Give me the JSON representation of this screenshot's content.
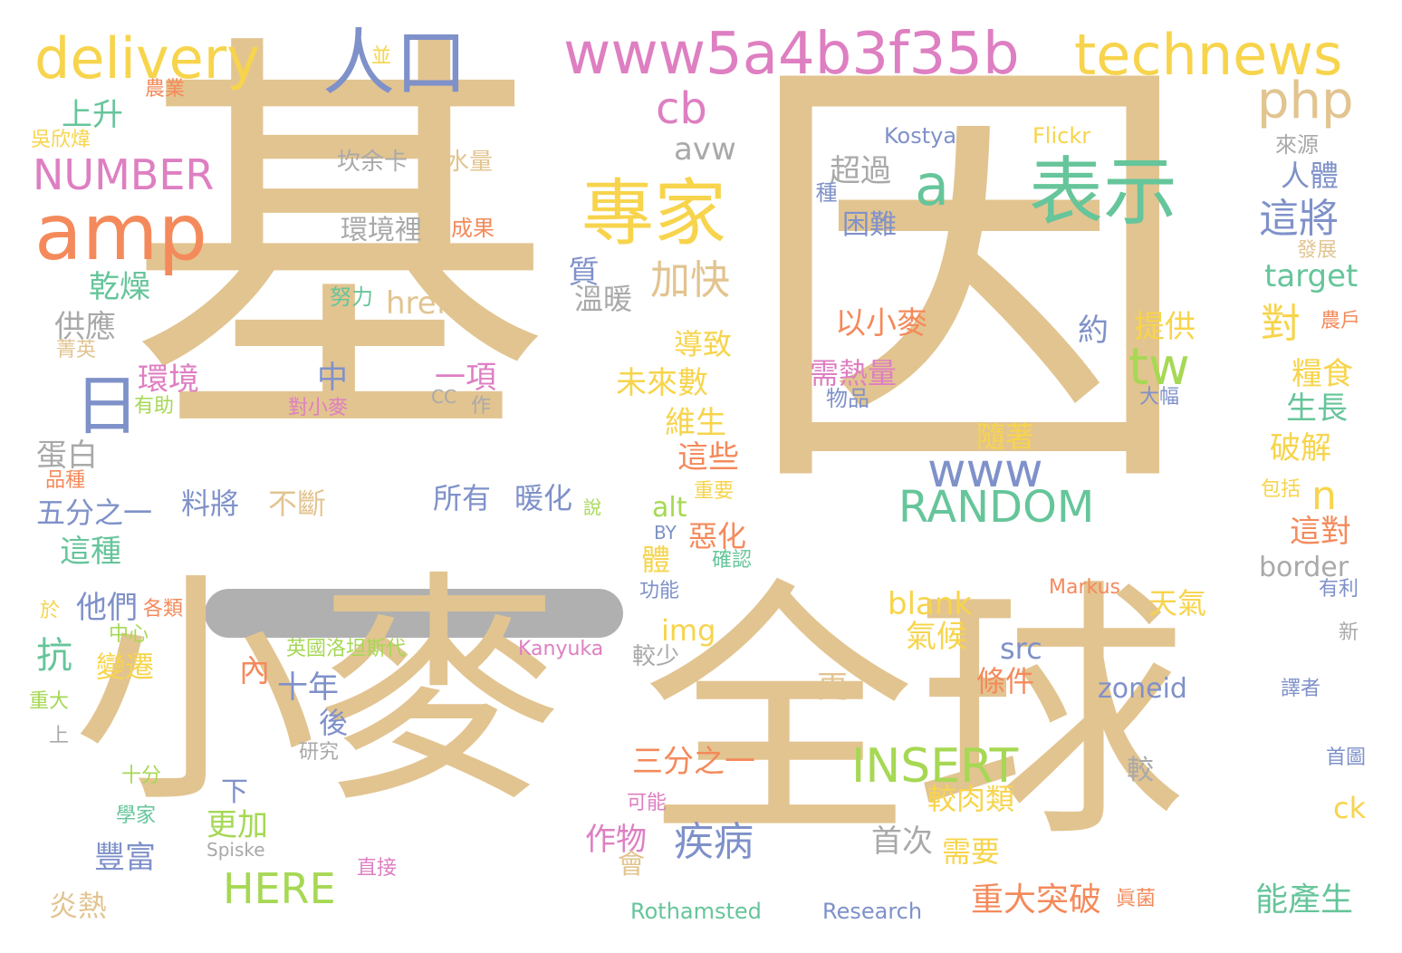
{
  "palette": {
    "tan": "#e2c490",
    "orange": "#f48a5b",
    "yellow": "#f7d44c",
    "pink": "#de7fc2",
    "blue": "#7f91c9",
    "green": "#66c59a",
    "lime": "#a6d854",
    "gray": "#a9a9a9"
  },
  "words": [
    {
      "text": "基",
      "size": 470,
      "color": "tan"
    },
    {
      "text": "因",
      "size": 500,
      "color": "tan"
    },
    {
      "text": "全球",
      "size": 300,
      "color": "tan"
    },
    {
      "text": "小麥",
      "size": 270,
      "color": "tan"
    },
    {
      "text": "amp",
      "size": 86,
      "color": "orange"
    },
    {
      "text": "delivery",
      "size": 62,
      "color": "yellow"
    },
    {
      "text": "人口",
      "size": 80,
      "color": "blue"
    },
    {
      "text": "www5a4b3f35b",
      "size": 64,
      "color": "pink"
    },
    {
      "text": "technews",
      "size": 62,
      "color": "yellow"
    },
    {
      "text": "php",
      "size": 56,
      "color": "tan"
    },
    {
      "text": "cb",
      "size": 48,
      "color": "pink"
    },
    {
      "text": "專家",
      "size": 80,
      "color": "yellow"
    },
    {
      "text": "a",
      "size": 62,
      "color": "green"
    },
    {
      "text": "表示",
      "size": 82,
      "color": "green"
    },
    {
      "text": "NUMBER",
      "size": 46,
      "color": "pink"
    },
    {
      "text": "上升",
      "size": 34,
      "color": "green"
    },
    {
      "text": "吳欣煒",
      "size": 22,
      "color": "yellow"
    },
    {
      "text": "農業",
      "size": 22,
      "color": "orange"
    },
    {
      "text": "並",
      "size": 22,
      "color": "yellow"
    },
    {
      "text": "日",
      "size": 72,
      "color": "blue"
    },
    {
      "text": "avw",
      "size": 34,
      "color": "gray"
    },
    {
      "text": "Kostya",
      "size": 24,
      "color": "blue"
    },
    {
      "text": "Flickr",
      "size": 24,
      "color": "yellow"
    },
    {
      "text": "來源",
      "size": 24,
      "color": "gray"
    },
    {
      "text": "坎余卡",
      "size": 26,
      "color": "gray"
    },
    {
      "text": "需水量",
      "size": 26,
      "color": "tan"
    },
    {
      "text": "超過",
      "size": 34,
      "color": "gray"
    },
    {
      "text": "人體",
      "size": 32,
      "color": "blue"
    },
    {
      "text": "這將",
      "size": 44,
      "color": "blue"
    },
    {
      "text": "種",
      "size": 24,
      "color": "blue"
    },
    {
      "text": "困難",
      "size": 30,
      "color": "blue"
    },
    {
      "text": "環境裡",
      "size": 30,
      "color": "gray"
    },
    {
      "text": "成果",
      "size": 24,
      "color": "orange"
    },
    {
      "text": "加快",
      "size": 44,
      "color": "tan"
    },
    {
      "text": "發展",
      "size": 22,
      "color": "tan"
    },
    {
      "text": "target",
      "size": 34,
      "color": "green"
    },
    {
      "text": "乾燥",
      "size": 34,
      "color": "green"
    },
    {
      "text": "努力",
      "size": 24,
      "color": "green"
    },
    {
      "text": "href",
      "size": 34,
      "color": "tan"
    },
    {
      "text": "質",
      "size": 34,
      "color": "blue"
    },
    {
      "text": "溫暖",
      "size": 32,
      "color": "gray"
    },
    {
      "text": "以小麥",
      "size": 34,
      "color": "orange"
    },
    {
      "text": "約",
      "size": 34,
      "color": "blue"
    },
    {
      "text": "提供",
      "size": 34,
      "color": "yellow"
    },
    {
      "text": "對",
      "size": 44,
      "color": "yellow"
    },
    {
      "text": "農戶",
      "size": 22,
      "color": "orange"
    },
    {
      "text": "供應",
      "size": 34,
      "color": "gray"
    },
    {
      "text": "菁英",
      "size": 22,
      "color": "tan"
    },
    {
      "text": "導致",
      "size": 32,
      "color": "yellow"
    },
    {
      "text": "tw",
      "size": 56,
      "color": "lime"
    },
    {
      "text": "糧食",
      "size": 34,
      "color": "yellow"
    },
    {
      "text": "環境",
      "size": 34,
      "color": "pink"
    },
    {
      "text": "中",
      "size": 34,
      "color": "blue"
    },
    {
      "text": "一項",
      "size": 34,
      "color": "pink"
    },
    {
      "text": "未來數",
      "size": 34,
      "color": "yellow"
    },
    {
      "text": "需熱量",
      "size": 32,
      "color": "pink"
    },
    {
      "text": "有助",
      "size": 22,
      "color": "lime"
    },
    {
      "text": "對小麥",
      "size": 22,
      "color": "pink"
    },
    {
      "text": "CC",
      "size": 20,
      "color": "gray"
    },
    {
      "text": "作",
      "size": 22,
      "color": "gray"
    },
    {
      "text": "物品",
      "size": 24,
      "color": "blue"
    },
    {
      "text": "大幅",
      "size": 22,
      "color": "blue"
    },
    {
      "text": "生長",
      "size": 34,
      "color": "green"
    },
    {
      "text": "維生",
      "size": 34,
      "color": "yellow"
    },
    {
      "text": "隨著",
      "size": 32,
      "color": "yellow"
    },
    {
      "text": "蛋白",
      "size": 34,
      "color": "gray"
    },
    {
      "text": "這些",
      "size": 34,
      "color": "orange"
    },
    {
      "text": "www",
      "size": 52,
      "color": "blue"
    },
    {
      "text": "破解",
      "size": 34,
      "color": "yellow"
    },
    {
      "text": "品種",
      "size": 22,
      "color": "orange"
    },
    {
      "text": "n",
      "size": 44,
      "color": "yellow"
    },
    {
      "text": "包括",
      "size": 22,
      "color": "yellow"
    },
    {
      "text": "五分之一",
      "size": 32,
      "color": "blue"
    },
    {
      "text": "料將",
      "size": 32,
      "color": "blue"
    },
    {
      "text": "不斷",
      "size": 32,
      "color": "tan"
    },
    {
      "text": "所有",
      "size": 32,
      "color": "blue"
    },
    {
      "text": "暖化",
      "size": 32,
      "color": "blue"
    },
    {
      "text": "說",
      "size": 20,
      "color": "lime"
    },
    {
      "text": "RANDOM",
      "size": 48,
      "color": "green"
    },
    {
      "text": "alt",
      "size": 30,
      "color": "lime"
    },
    {
      "text": "重要",
      "size": 22,
      "color": "yellow"
    },
    {
      "text": "這對",
      "size": 34,
      "color": "orange"
    },
    {
      "text": "這種",
      "size": 34,
      "color": "green"
    },
    {
      "text": "BY",
      "size": 20,
      "color": "blue"
    },
    {
      "text": "惡化",
      "size": 32,
      "color": "orange"
    },
    {
      "text": "體",
      "size": 32,
      "color": "yellow"
    },
    {
      "text": "確認",
      "size": 22,
      "color": "green"
    },
    {
      "text": "border",
      "size": 30,
      "color": "gray"
    },
    {
      "text": "功能",
      "size": 22,
      "color": "blue"
    },
    {
      "text": "Markus",
      "size": 22,
      "color": "orange"
    },
    {
      "text": "有利",
      "size": 22,
      "color": "blue"
    },
    {
      "text": "於",
      "size": 22,
      "color": "yellow"
    },
    {
      "text": "各類",
      "size": 22,
      "color": "orange"
    },
    {
      "text": "他們",
      "size": 34,
      "color": "blue"
    },
    {
      "text": "blank",
      "size": 34,
      "color": "yellow"
    },
    {
      "text": "天氣",
      "size": 32,
      "color": "yellow"
    },
    {
      "text": "中心",
      "size": 22,
      "color": "lime"
    },
    {
      "text": "img",
      "size": 32,
      "color": "yellow"
    },
    {
      "text": "氣候",
      "size": 34,
      "color": "yellow"
    },
    {
      "text": "新",
      "size": 22,
      "color": "gray"
    },
    {
      "text": "抗",
      "size": 40,
      "color": "green"
    },
    {
      "text": "英國洛坦斯代",
      "size": 22,
      "color": "lime"
    },
    {
      "text": "Kanyuka",
      "size": 22,
      "color": "pink"
    },
    {
      "text": "較少",
      "size": 26,
      "color": "gray"
    },
    {
      "text": "src",
      "size": 32,
      "color": "blue"
    },
    {
      "text": "變遷",
      "size": 32,
      "color": "yellow"
    },
    {
      "text": "內",
      "size": 34,
      "color": "orange"
    },
    {
      "text": "十年",
      "size": 34,
      "color": "blue"
    },
    {
      "text": "條件",
      "size": 32,
      "color": "orange"
    },
    {
      "text": "zoneid",
      "size": 30,
      "color": "blue"
    },
    {
      "text": "譯者",
      "size": 22,
      "color": "blue"
    },
    {
      "text": "重大",
      "size": 22,
      "color": "lime"
    },
    {
      "text": "更",
      "size": 34,
      "color": "tan"
    },
    {
      "text": "後",
      "size": 32,
      "color": "blue"
    },
    {
      "text": "上",
      "size": 22,
      "color": "gray"
    },
    {
      "text": "研究",
      "size": 22,
      "color": "gray"
    },
    {
      "text": "INSERT",
      "size": 52,
      "color": "lime"
    },
    {
      "text": "三分之一",
      "size": 34,
      "color": "orange"
    },
    {
      "text": "首圖",
      "size": 22,
      "color": "blue"
    },
    {
      "text": "十分",
      "size": 22,
      "color": "lime"
    },
    {
      "text": "較",
      "size": 30,
      "color": "gray"
    },
    {
      "text": "下",
      "size": 30,
      "color": "blue"
    },
    {
      "text": "可能",
      "size": 22,
      "color": "pink"
    },
    {
      "text": "較肉類",
      "size": 32,
      "color": "yellow"
    },
    {
      "text": "ck",
      "size": 32,
      "color": "yellow"
    },
    {
      "text": "學家",
      "size": 22,
      "color": "green"
    },
    {
      "text": "更加",
      "size": 34,
      "color": "lime"
    },
    {
      "text": "作物",
      "size": 34,
      "color": "pink"
    },
    {
      "text": "疾病",
      "size": 44,
      "color": "blue"
    },
    {
      "text": "首次",
      "size": 34,
      "color": "gray"
    },
    {
      "text": "Spiske",
      "size": 20,
      "color": "gray"
    },
    {
      "text": "豐富",
      "size": 34,
      "color": "blue"
    },
    {
      "text": "需要",
      "size": 32,
      "color": "yellow"
    },
    {
      "text": "會",
      "size": 30,
      "color": "tan"
    },
    {
      "text": "直接",
      "size": 22,
      "color": "pink"
    },
    {
      "text": "HERE",
      "size": 46,
      "color": "lime"
    },
    {
      "text": "炎熱",
      "size": 32,
      "color": "tan"
    },
    {
      "text": "重大突破",
      "size": 36,
      "color": "orange"
    },
    {
      "text": "眞菌",
      "size": 22,
      "color": "orange"
    },
    {
      "text": "能產生",
      "size": 36,
      "color": "green"
    },
    {
      "text": "Rothamsted",
      "size": 24,
      "color": "green"
    },
    {
      "text": "Research",
      "size": 24,
      "color": "blue"
    }
  ]
}
